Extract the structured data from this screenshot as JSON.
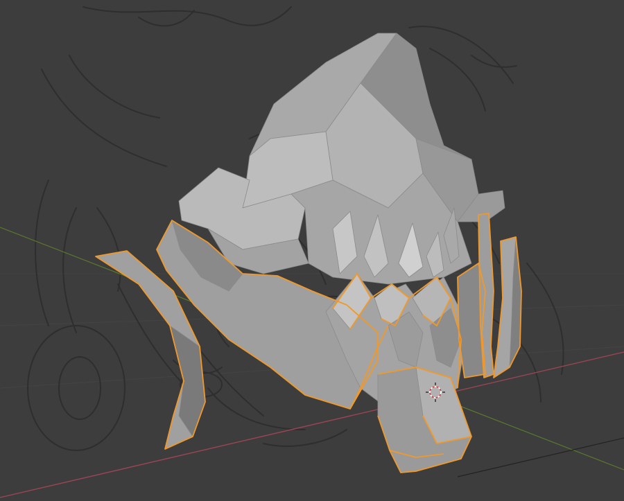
{
  "viewport": {
    "background_color": "#3d3d3d",
    "shading_mode": "solid",
    "object_mode": "edit-selection",
    "axis_colors": {
      "x_axis": "#9b4554",
      "y_axis": "#5b7a2d"
    },
    "selection_outline_color": "#f0992a",
    "mesh_colors": {
      "light": "#b7b7b7",
      "mid": "#9c9c9c",
      "dark": "#7a7a7a",
      "deep": "#5f5f5f"
    },
    "reference_sketch_color": "#2e2e2e",
    "icons": {
      "cursor": "3d-cursor-icon"
    }
  }
}
